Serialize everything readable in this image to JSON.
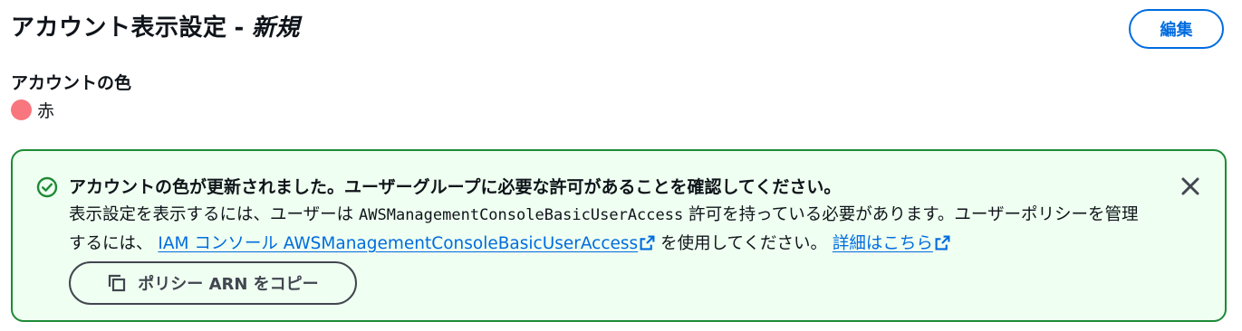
{
  "header": {
    "title": "アカウント表示設定",
    "separator": "-",
    "status": "新規",
    "edit_label": "編集"
  },
  "account_color": {
    "label": "アカウントの色",
    "value": "赤",
    "swatch": "#f8767d"
  },
  "alert": {
    "title": "アカウントの色が更新されました。ユーザーグループに必要な許可があることを確認してください。",
    "body_1": "表示設定を表示するには、ユーザーは ",
    "policy_name": "AWSManagementConsoleBasicUserAccess",
    "body_2": " 許可を持っている必要があります。ユーザーポリシーを管理するには、 ",
    "iam_link": "IAM コンソール AWSManagementConsoleBasicUserAccess",
    "body_3": " を使用してください。 ",
    "details_link": "詳細はこちら",
    "copy_label": "ポリシー ARN をコピー",
    "border_color": "#1d8a36",
    "background_color": "#effff1"
  },
  "colors": {
    "accent": "#006ce0",
    "text": "#0f141a",
    "success": "#1d8a36"
  },
  "icons": [
    "success-check-icon",
    "close-icon",
    "external-link-icon",
    "copy-icon"
  ]
}
